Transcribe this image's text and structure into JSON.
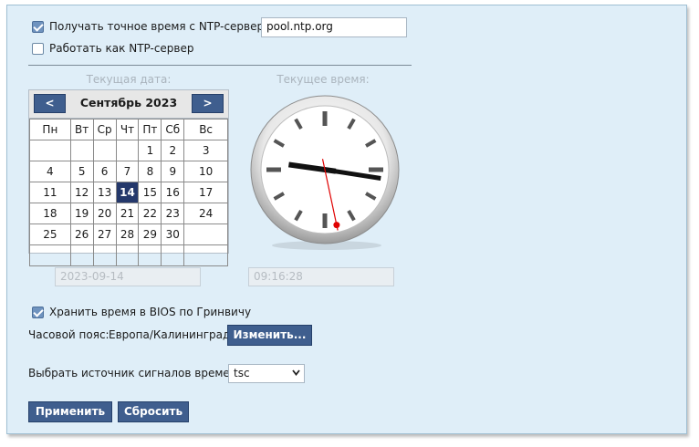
{
  "ntp": {
    "client_label": "Получать точное время с NTP-сервера:",
    "client_checked": true,
    "server_value": "pool.ntp.org",
    "server_mode_label": "Работать как NTP-сервер",
    "server_mode_checked": false
  },
  "date_section": {
    "caption": "Текущая дата:",
    "month_title": "Сентябрь 2023",
    "prev_label": "<",
    "next_label": ">",
    "weekdays": [
      "Пн",
      "Вт",
      "Ср",
      "Чт",
      "Пт",
      "Сб",
      "Вс"
    ],
    "weeks": [
      [
        "",
        "",
        "",
        "",
        "1",
        "2",
        "3"
      ],
      [
        "4",
        "5",
        "6",
        "7",
        "8",
        "9",
        "10"
      ],
      [
        "11",
        "12",
        "13",
        "14",
        "15",
        "16",
        "17"
      ],
      [
        "18",
        "19",
        "20",
        "21",
        "22",
        "23",
        "24"
      ],
      [
        "25",
        "26",
        "27",
        "28",
        "29",
        "30",
        ""
      ],
      [
        "",
        "",
        "",
        "",
        "",
        "",
        ""
      ]
    ],
    "selected_day": "14",
    "date_value": "2023-09-14"
  },
  "time_section": {
    "caption": "Текущее время:",
    "time_value": "09:16:28"
  },
  "bios": {
    "label": "Хранить время в BIOS по Гринвичу",
    "checked": true
  },
  "timezone": {
    "label": "Часовой пояс:",
    "value": "Европа/Калининград",
    "change_button": "Изменить..."
  },
  "clocksource": {
    "label": "Выбрать источник сигналов времени:",
    "selected": "tsc"
  },
  "actions": {
    "apply": "Применить",
    "reset": "Сбросить"
  },
  "colors": {
    "panel_bg": "#dfeef8",
    "button_bg": "#3f5e8e",
    "selected_day_bg": "#24386b",
    "second_hand": "#e00000"
  }
}
